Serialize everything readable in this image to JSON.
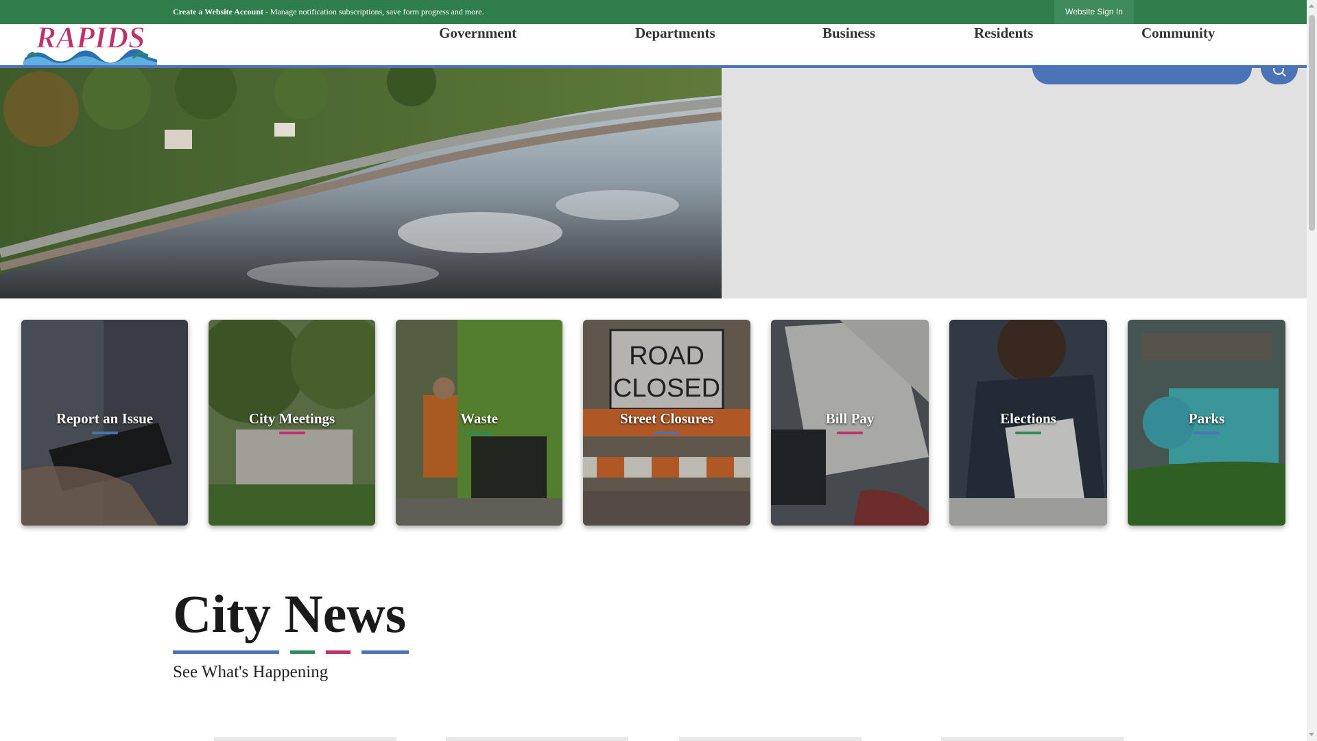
{
  "topbar": {
    "create_account": "Create a Website Account",
    "message": " - Manage notification subscriptions, save form progress and more.",
    "signin_label": "Website Sign In"
  },
  "logo": {
    "text": "RAPIDS"
  },
  "nav": {
    "items": [
      {
        "label": "Government"
      },
      {
        "label": "Departments"
      },
      {
        "label": "Business"
      },
      {
        "label": "Residents"
      },
      {
        "label": "Community"
      }
    ]
  },
  "search": {
    "icon": "search-icon"
  },
  "tiles": [
    {
      "label": "Report an Issue",
      "accent": "#4a73b8"
    },
    {
      "label": "City Meetings",
      "accent": "#c0306a"
    },
    {
      "label": "Waste",
      "accent": "#2e8b57"
    },
    {
      "label": "Street Closures",
      "accent": "#4a73b8"
    },
    {
      "label": "Bill Pay",
      "accent": "#c0306a"
    },
    {
      "label": "Elections",
      "accent": "#2e8b57"
    },
    {
      "label": "Parks",
      "accent": "#4a73b8"
    }
  ],
  "news": {
    "title": "City News",
    "subtitle": "See What's Happening"
  },
  "colors": {
    "topbar_green": "#2e7d4a",
    "brand_blue": "#4a73b8",
    "brand_green": "#2e8b57",
    "brand_pink": "#c0306a"
  }
}
